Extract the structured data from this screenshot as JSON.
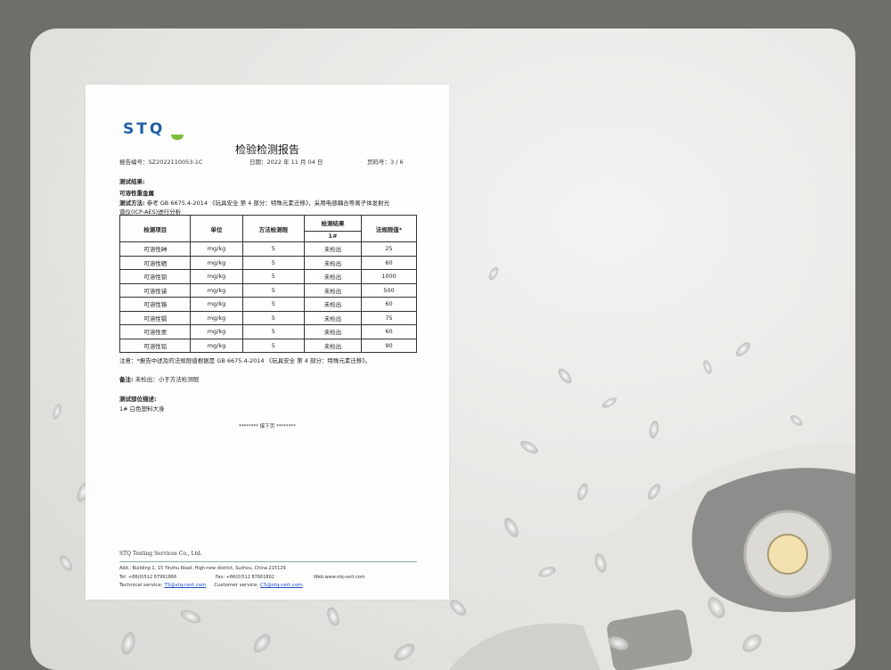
{
  "document": {
    "logo": "STQ",
    "title": "检验检测报告",
    "report_no": "报告编号：SZ2022110053-1C",
    "date": "日期：2022 年 11 月 04 日",
    "page_no": "页码号：3 / 6",
    "results_heading": "测试结果:",
    "subheading": "可溶性重金属",
    "method_label": "测试方法:",
    "method_line1": "参考 GB 6675.4-2014 《玩具安全 第 4 部分：特殊元素迁移》，采用电感耦合等离子体发射光",
    "method_line2": "谱仪(ICP-AES)进行分析",
    "table": {
      "headers": {
        "item": "检测项目",
        "unit": "单位",
        "limit": "方法检测限",
        "result": "检测结果",
        "sample": "1#",
        "standard": "法规限值*"
      },
      "rows": [
        {
          "item": "可溶性砷",
          "unit": "mg/kg",
          "limit": "5",
          "result": "未检出",
          "standard": "25"
        },
        {
          "item": "可溶性硒",
          "unit": "mg/kg",
          "limit": "5",
          "result": "未检出",
          "standard": "60"
        },
        {
          "item": "可溶性钡",
          "unit": "mg/kg",
          "limit": "5",
          "result": "未检出",
          "standard": "1000"
        },
        {
          "item": "可溶性锑",
          "unit": "mg/kg",
          "limit": "5",
          "result": "未检出",
          "standard": "500"
        },
        {
          "item": "可溶性铬",
          "unit": "mg/kg",
          "limit": "5",
          "result": "未检出",
          "standard": "60"
        },
        {
          "item": "可溶性镉",
          "unit": "mg/kg",
          "limit": "5",
          "result": "未检出",
          "standard": "75"
        },
        {
          "item": "可溶性汞",
          "unit": "mg/kg",
          "limit": "5",
          "result": "未检出",
          "standard": "60"
        },
        {
          "item": "可溶性铅",
          "unit": "mg/kg",
          "limit": "5",
          "result": "未检出",
          "standard": "90"
        }
      ]
    },
    "note": "注意：*报告中述及的法规限值根据是 GB 6675.4-2014 《玩具安全 第 4 部分：特殊元素迁移》。",
    "remark_label": "备注:",
    "remark_text": "未检出：小于方法检测限",
    "part_label": "测试部位描述:",
    "part_text": "1# 白色塑料大身",
    "next_page": "******** 接下页 ********",
    "company": "STQ Testing Services Co., Ltd.",
    "address": "Add.: Building 1, 15 Yinzhu Road, High-new district, Suzhou, China 215129",
    "tel": "Tel: +86(0)512 67991866",
    "fax": "Fax: +86(0)512 87661802",
    "web": "Web:www.stq-cert.com",
    "tech_label": "Technical service:",
    "tech_email": "TS@stq-cert.com",
    "cust_label": "Customer service:",
    "cust_email": "CS@stq-cert.com"
  },
  "colors": {
    "frame": "#6f6f6a",
    "logo_blue": "#1f5fa6",
    "logo_green": "#7dbb3a",
    "link": "#1a4fc2"
  }
}
